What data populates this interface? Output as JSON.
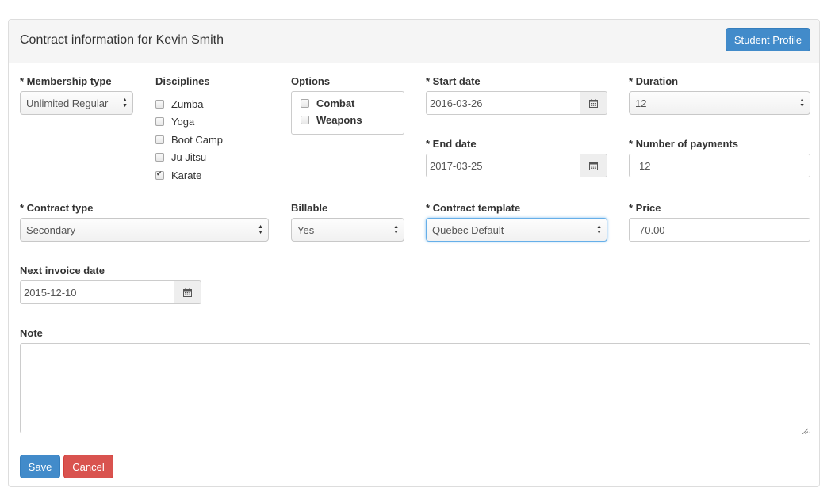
{
  "header": {
    "title": "Contract information for Kevin Smith",
    "student_profile_label": "Student Profile"
  },
  "membership_type": {
    "label": "* Membership type",
    "value": "Unlimited Regular"
  },
  "disciplines": {
    "label": "Disciplines",
    "items": [
      {
        "label": "Zumba",
        "checked": false
      },
      {
        "label": "Yoga",
        "checked": false
      },
      {
        "label": "Boot Camp",
        "checked": false
      },
      {
        "label": "Ju Jitsu",
        "checked": false
      },
      {
        "label": "Karate",
        "checked": true
      }
    ]
  },
  "options": {
    "label": "Options",
    "items": [
      {
        "label": "Combat",
        "checked": false
      },
      {
        "label": "Weapons",
        "checked": false
      }
    ]
  },
  "start_date": {
    "label": "* Start date",
    "value": "2016-03-26"
  },
  "end_date": {
    "label": "* End date",
    "value": "2017-03-25"
  },
  "duration": {
    "label": "* Duration",
    "value": "12"
  },
  "number_of_payments": {
    "label": "* Number of payments",
    "value": "12"
  },
  "contract_type": {
    "label": "* Contract type",
    "value": "Secondary"
  },
  "billable": {
    "label": "Billable",
    "value": "Yes"
  },
  "contract_template": {
    "label": "* Contract template",
    "value": "Quebec Default"
  },
  "price": {
    "label": "* Price",
    "value": "70.00"
  },
  "next_invoice_date": {
    "label": "Next invoice date",
    "value": "2015-12-10"
  },
  "note": {
    "label": "Note",
    "value": ""
  },
  "actions": {
    "save_label": "Save",
    "cancel_label": "Cancel"
  },
  "colors": {
    "primary": "#428bca",
    "danger": "#d9534f",
    "focus": "#66afe9",
    "heading_bg": "#f5f5f5"
  },
  "icons": {
    "calendar": "calendar-icon",
    "select_arrows": "select-arrows-icon",
    "checkbox": "checkbox-icon"
  }
}
